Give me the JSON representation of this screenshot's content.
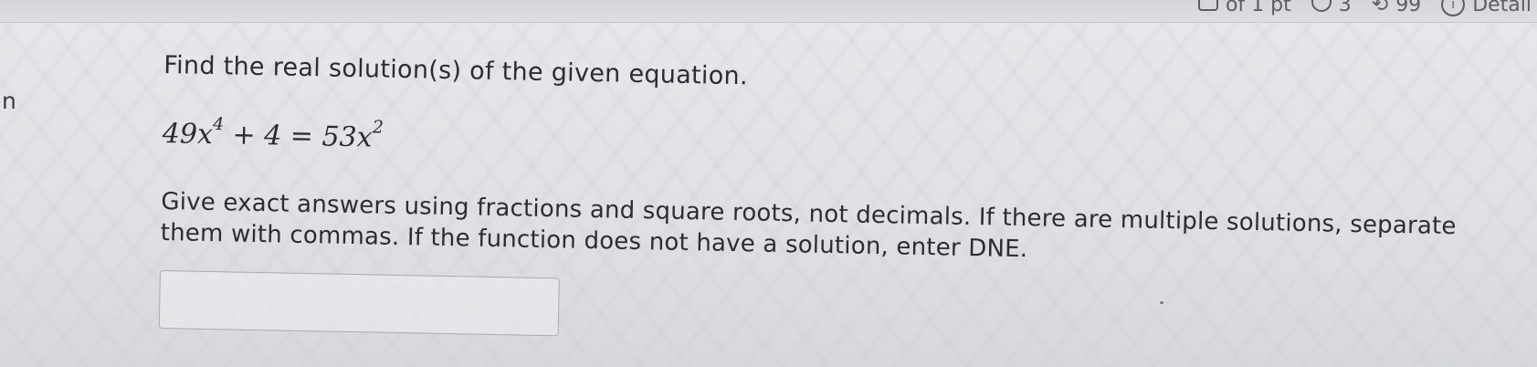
{
  "header": {
    "points_text": "of 1 pt",
    "attempts_text": "3",
    "submissions_text": "99",
    "details_label": "Detail"
  },
  "sidebar": {
    "fragment_text": "n"
  },
  "question": {
    "prompt": "Find the real solution(s) of the given equation.",
    "equation": {
      "coef1": "49",
      "var1": "x",
      "exp1": "4",
      "middle": " + 4 = 53",
      "var2": "x",
      "exp2": "2"
    },
    "instructions": "Give exact answers using fractions and square roots, not decimals. If there are multiple solutions, separate them with commas. If the function does not have a solution, enter DNE."
  },
  "answer": {
    "value": "",
    "placeholder": ""
  },
  "icons": {
    "points": "box-icon",
    "attempts": "retry-icon",
    "submissions": "history-icon",
    "details": "info-icon"
  }
}
